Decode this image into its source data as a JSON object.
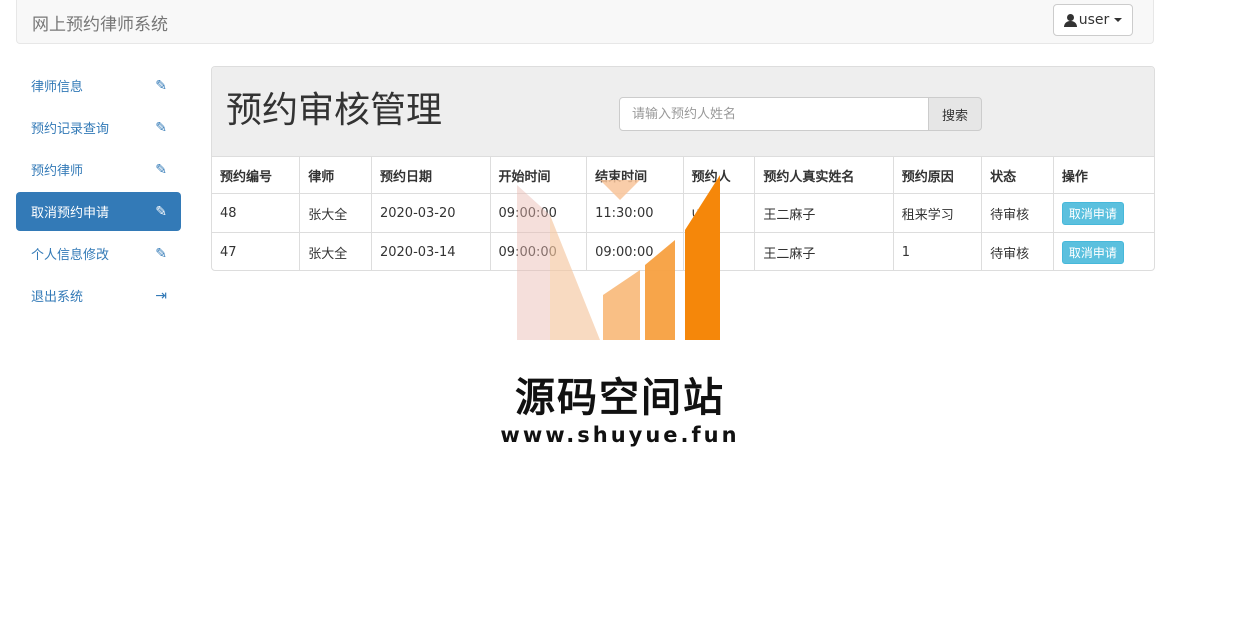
{
  "navbar": {
    "brand": "网上预约律师系统",
    "user_label": "user"
  },
  "sidebar": {
    "items": [
      {
        "label": "律师信息",
        "icon": "pencil-icon",
        "active": false
      },
      {
        "label": "预约记录查询",
        "icon": "pencil-icon",
        "active": false
      },
      {
        "label": "预约律师",
        "icon": "pencil-icon",
        "active": false
      },
      {
        "label": "取消预约申请",
        "icon": "pencil-icon",
        "active": true
      },
      {
        "label": "个人信息修改",
        "icon": "pencil-icon",
        "active": false
      },
      {
        "label": "退出系统",
        "icon": "logout-icon",
        "active": false
      }
    ]
  },
  "main": {
    "title": "预约审核管理",
    "search": {
      "placeholder": "请输入预约人姓名",
      "button_label": "搜索"
    },
    "table": {
      "headers": [
        "预约编号",
        "律师",
        "预约日期",
        "开始时间",
        "结束时间",
        "预约人",
        "预约人真实姓名",
        "预约原因",
        "状态",
        "操作"
      ],
      "rows": [
        {
          "id": "48",
          "lawyer": "张大全",
          "date": "2020-03-20",
          "start": "09:00:00",
          "end": "11:30:00",
          "user": "user",
          "real_name": "王二麻子",
          "reason": "租来学习",
          "status": "待审核",
          "action": "取消申请"
        },
        {
          "id": "47",
          "lawyer": "张大全",
          "date": "2020-03-14",
          "start": "09:00:00",
          "end": "09:00:00",
          "user": "user",
          "real_name": "王二麻子",
          "reason": "1",
          "status": "待审核",
          "action": "取消申请"
        }
      ]
    }
  },
  "watermark": {
    "title": "源码空间站",
    "url": "www.shuyue.fun"
  },
  "colors": {
    "primary": "#337ab7",
    "info": "#5bc0de",
    "watermark_orange": "#f5870a"
  }
}
